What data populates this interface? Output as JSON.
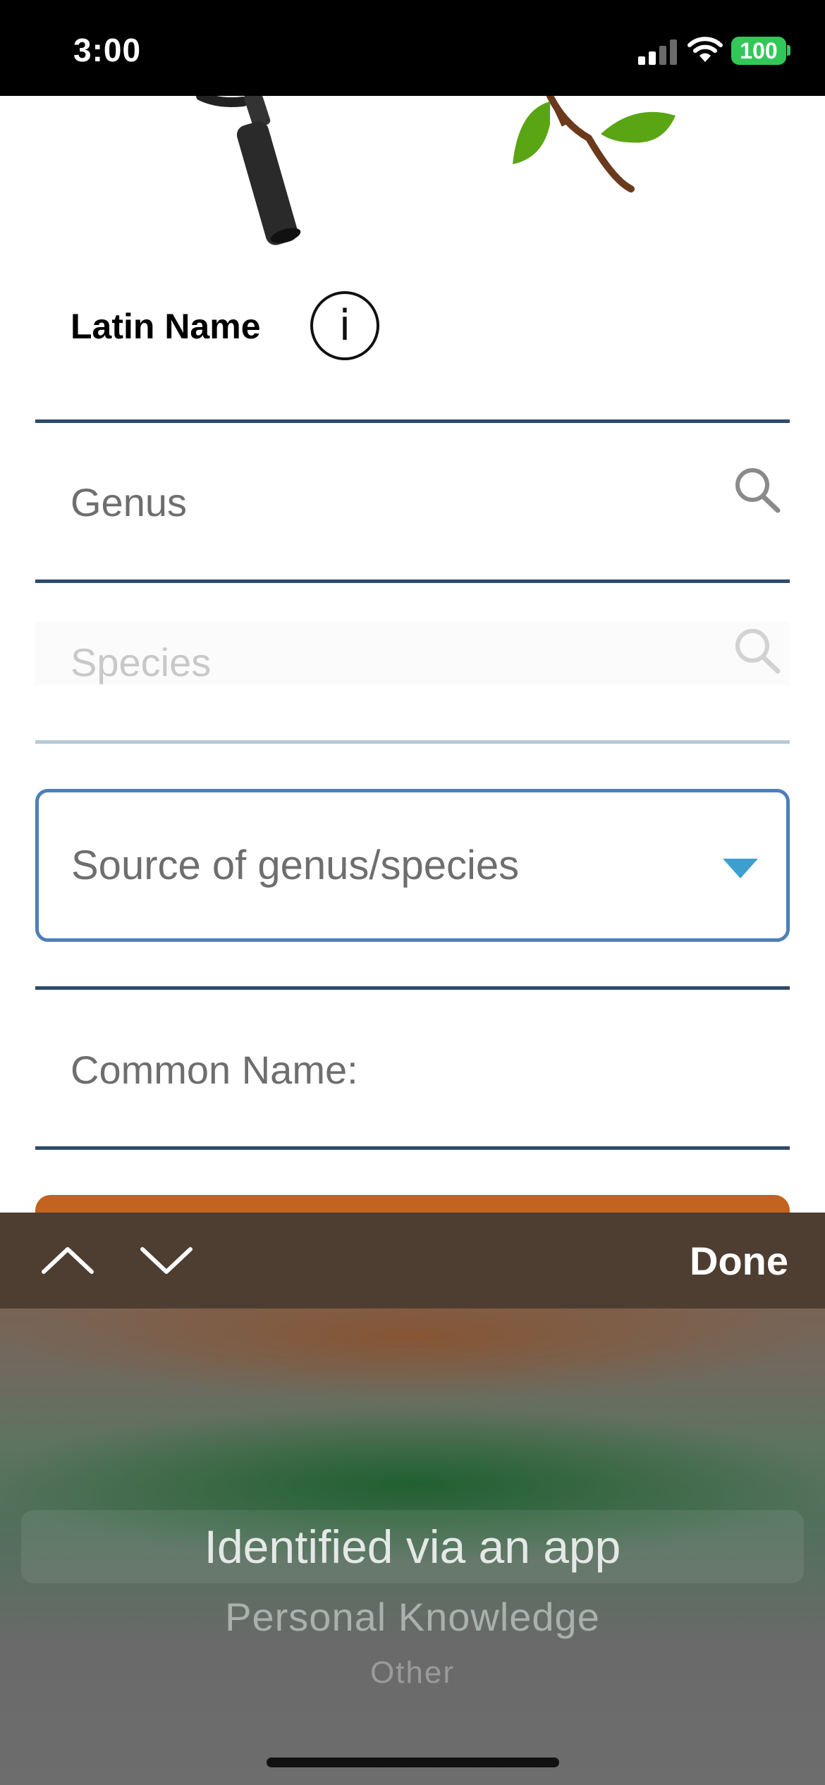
{
  "status_bar": {
    "time": "3:00",
    "battery": "100",
    "icons": [
      "signal-icon",
      "wifi-icon",
      "battery-icon"
    ]
  },
  "form": {
    "latin_name_label": "Latin Name",
    "info_icon_glyph": "i",
    "genus_placeholder": "Genus",
    "species_placeholder": "Species",
    "source_dropdown_label": "Source of genus/species",
    "common_name_placeholder": "Common Name:"
  },
  "picker_toolbar": {
    "done_label": "Done",
    "icons": [
      "chevron-up-icon",
      "chevron-down-icon"
    ]
  },
  "picker": {
    "selected": "Identified via an app",
    "options": [
      "Identified via an app",
      "Personal Knowledge",
      "Other"
    ]
  },
  "colors": {
    "field_rule": "#2e4a6e",
    "dropdown_border": "#4f7fb8",
    "dropdown_caret": "#3d9fd0",
    "toolbar_bg": "#4e3d31",
    "accent_orange": "#c2631f",
    "battery_green": "#33c759"
  }
}
